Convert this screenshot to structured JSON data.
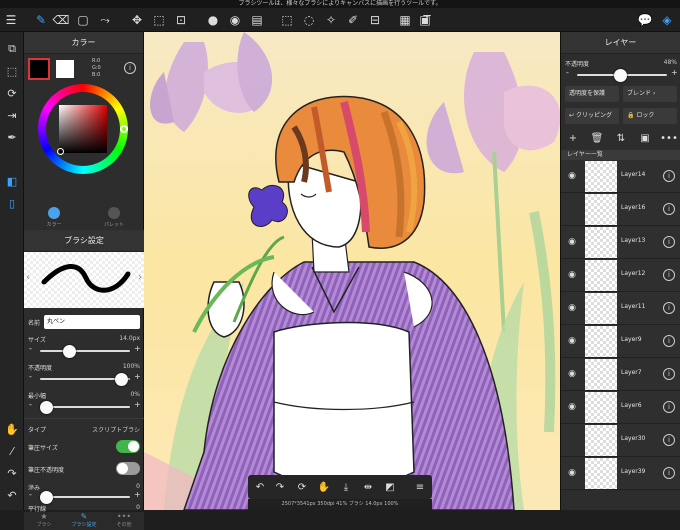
{
  "status_text": "ブラシツールは、様々なブラシによりキャンバスに描画を行うツールです。",
  "toolbar": {
    "icons": [
      "menu-icon",
      "brush-icon",
      "eraser-icon",
      "rectangle-icon",
      "stabilizer-icon",
      "move-icon",
      "transform-icon",
      "mesh-transform-icon",
      "fill-icon",
      "bucket-icon",
      "gradation-icon",
      "select-icon",
      "lasso-icon",
      "magic-wand-icon",
      "select-pen-icon",
      "select-eraser-icon",
      "panel-icon",
      "text-icon",
      "chat-icon",
      "layers-icon"
    ],
    "text_tool_label": "T"
  },
  "color_panel": {
    "title": "カラー",
    "rgb": [
      "R:0",
      "G:0",
      "B:0"
    ],
    "tab_color": "カラー",
    "tab_palette": "パレット",
    "main_color": "#000000",
    "sub_color": "#ffffff"
  },
  "brush_panel": {
    "title": "ブラシ設定",
    "name_label": "名前",
    "name_value": "丸ペン",
    "size_label": "サイズ",
    "size_value": "14.0px",
    "size_level": 0.3,
    "opacity_label": "不透明度",
    "opacity_value": "100%",
    "opacity_level": 0.98,
    "min_width_label": "最小幅",
    "min_width_value": "0%",
    "min_width_level": 0.0,
    "type_label": "タイプ",
    "type_value": "スクリプトブラシ",
    "pressure_size_label": "筆圧サイズ",
    "pressure_size_on": true,
    "pressure_opacity_label": "筆圧不透明度",
    "pressure_opacity_on": false,
    "blur_label": "滲み",
    "blur_value": "0",
    "blur_level": 0.0,
    "parallel_label": "平行線",
    "parallel_value": "0",
    "bottom_tabs": [
      "ブラシ",
      "ブラシ設定",
      "その他"
    ]
  },
  "canvas_info": "2507*3541px 350dpi 41% ブラシ 14.0px 100%",
  "layer_panel": {
    "title": "レイヤー",
    "opacity_label": "不透明度",
    "opacity_value": "48%",
    "opacity_level": 0.48,
    "protect_label": "透明度を保護",
    "blend_label": "ブレンド",
    "clipping_label": "クリッピング",
    "lock_label": "ロック",
    "list_title": "レイヤー一覧",
    "layers": [
      {
        "name": "Layer14",
        "visible": true
      },
      {
        "name": "Layer16",
        "visible": false
      },
      {
        "name": "Layer13",
        "visible": true
      },
      {
        "name": "Layer12",
        "visible": true
      },
      {
        "name": "Layer11",
        "visible": true
      },
      {
        "name": "Layer9",
        "visible": true
      },
      {
        "name": "Layer7",
        "visible": true
      },
      {
        "name": "Layer6",
        "visible": true
      },
      {
        "name": "Layer30",
        "visible": false
      },
      {
        "name": "Layer39",
        "visible": true
      }
    ]
  }
}
